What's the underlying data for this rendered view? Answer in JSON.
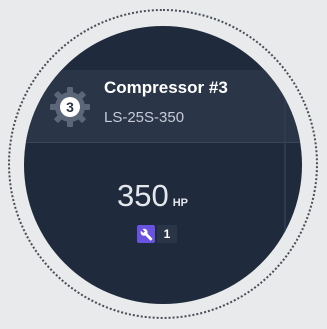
{
  "equipment": {
    "title": "Compressor #3",
    "model": "LS-25S-350",
    "icon": "gear-icon",
    "icon_number": "3"
  },
  "metric": {
    "value": "350",
    "unit": "HP"
  },
  "work_orders": {
    "icon": "wrench-icon",
    "count": "1",
    "accent_color": "#6a52e0"
  },
  "colors": {
    "panel_background": "#1f2a3c",
    "header_background": "#2a3547"
  }
}
